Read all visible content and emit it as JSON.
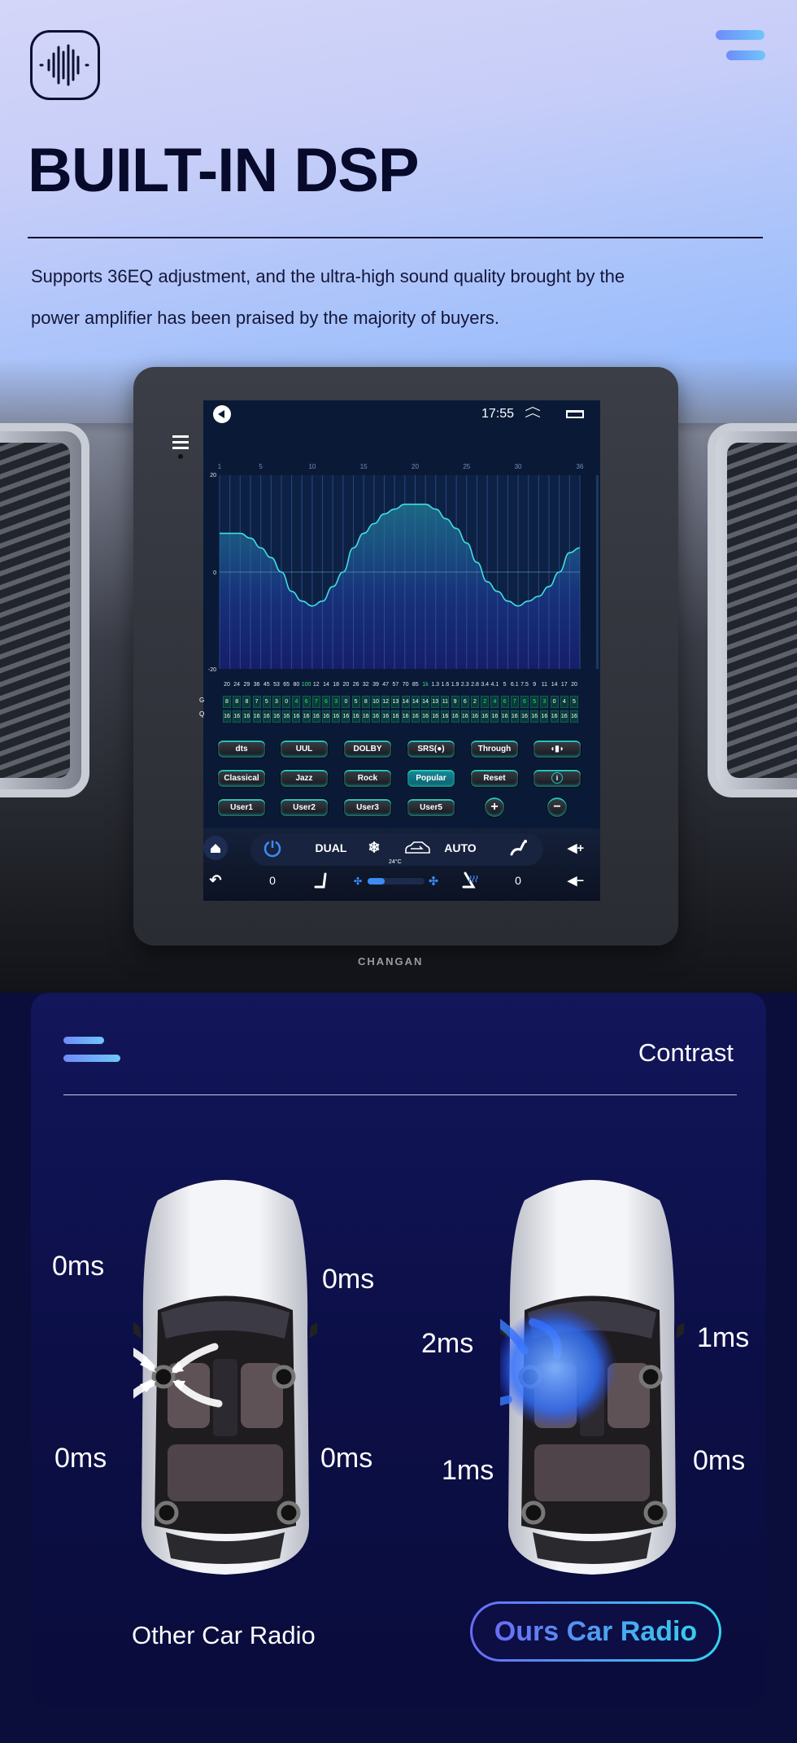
{
  "header": {
    "logo_icon": "sound-wave-icon",
    "menu_icon": "hamburger-menu-icon",
    "title": "BUILT-IN DSP",
    "description_lines": [
      "Supports 36EQ adjustment, and the ultra-high sound quality brought by the",
      "power amplifier has been praised by the majority of buyers."
    ]
  },
  "device": {
    "dash_brand": "CHANGAN",
    "status_bar": {
      "time": "17:55",
      "icons": [
        "back-icon",
        "chevron-up-double-icon",
        "recent-apps-icon"
      ]
    },
    "eq_row_labels": [
      "G",
      "Q"
    ],
    "frequencies": [
      "20",
      "24",
      "29",
      "36",
      "45",
      "53",
      "65",
      "80",
      "100",
      "12",
      "14",
      "18",
      "20",
      "26",
      "32",
      "39",
      "47",
      "57",
      "70",
      "85",
      "1k",
      "1.3",
      "1.6",
      "1.9",
      "2.3",
      "2.8",
      "3.4",
      "4.1",
      "5",
      "6.1",
      "7.5",
      "9",
      "11",
      "14",
      "17",
      "20"
    ],
    "highlighted_frequencies": [
      "100",
      "1k"
    ],
    "gain_display": [
      "8",
      "8",
      "8",
      "7",
      "5",
      "3",
      "0",
      "4",
      "6",
      "7",
      "6",
      "3",
      "0",
      "5",
      "8",
      "10",
      "12",
      "13",
      "14",
      "14",
      "14",
      "13",
      "11",
      "9",
      "6",
      "2",
      "2",
      "4",
      "6",
      "7",
      "6",
      "5",
      "3",
      "0",
      "4",
      "5"
    ],
    "q_values": [
      "16",
      "16",
      "16",
      "16",
      "16",
      "16",
      "16",
      "16",
      "16",
      "16",
      "16",
      "16",
      "16",
      "16",
      "16",
      "16",
      "16",
      "16",
      "16",
      "16",
      "16",
      "16",
      "16",
      "16",
      "16",
      "16",
      "16",
      "16",
      "16",
      "16",
      "16",
      "16",
      "16",
      "16",
      "16",
      "16"
    ],
    "effect_buttons": [
      "dts",
      "UUL",
      "DOLBY",
      "SRS(●)",
      "Through",
      ""
    ],
    "preset_buttons": [
      "Classical",
      "Jazz",
      "Rock",
      "Popular",
      "Reset",
      ""
    ],
    "user_buttons": [
      "User1",
      "User2",
      "User3",
      "User5",
      "+",
      "−"
    ],
    "active_preset": "Popular",
    "climate": {
      "dual": "DUAL",
      "auto": "AUTO",
      "temperature": "24°C",
      "left_seat_level": "0",
      "right_seat_level": "0",
      "fan_level_percent": 30
    },
    "accent_color": "#1ec5c2",
    "negative_gain_color": "#33e07a"
  },
  "chart_data": {
    "type": "area",
    "x": [
      1,
      2,
      3,
      4,
      5,
      6,
      7,
      8,
      9,
      10,
      11,
      12,
      13,
      14,
      15,
      16,
      17,
      18,
      19,
      20,
      21,
      22,
      23,
      24,
      25,
      26,
      27,
      28,
      29,
      30,
      31,
      32,
      33,
      34,
      35,
      36
    ],
    "values": [
      8,
      8,
      8,
      7,
      5,
      3,
      0,
      -4,
      -6,
      -7,
      -6,
      -3,
      0,
      5,
      8,
      10,
      12,
      13,
      14,
      14,
      14,
      13,
      11,
      9,
      6,
      2,
      -2,
      -4,
      -6,
      -7,
      -6,
      -5,
      -3,
      0,
      4,
      5
    ],
    "x_tick_labels": [
      "1",
      "5",
      "10",
      "15",
      "20",
      "25",
      "30",
      "36"
    ],
    "y_tick_labels": [
      "20",
      "0",
      "-20"
    ],
    "ylim": [
      -20,
      20
    ],
    "grid": true
  },
  "contrast": {
    "menu_icon": "hamburger-menu-icon",
    "title": "Contrast",
    "other": {
      "caption": "Other Car Radio",
      "delays": {
        "front_left": "0ms",
        "front_right": "0ms",
        "rear_left": "0ms",
        "rear_right": "0ms"
      }
    },
    "ours": {
      "caption": "Ours Car Radio",
      "delays": {
        "front_left": "2ms",
        "front_right": "1ms",
        "rear_left": "1ms",
        "rear_right": "0ms"
      }
    },
    "highlight_gradient": [
      "#6a6cf6",
      "#32d3ef"
    ]
  }
}
